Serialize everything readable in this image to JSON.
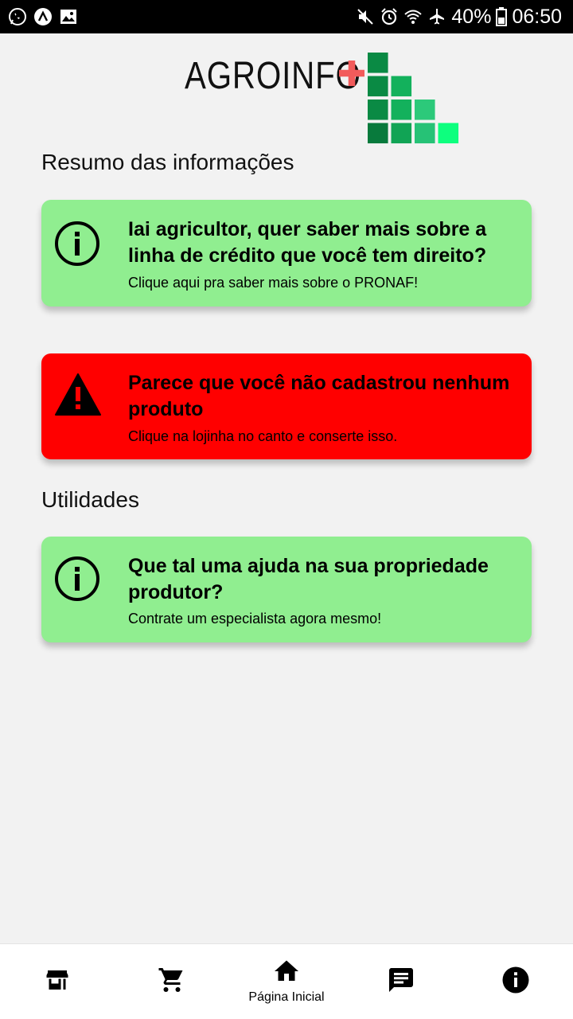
{
  "status_bar": {
    "battery": "40%",
    "time": "06:50",
    "left_icons": [
      "whatsapp-icon",
      "app-icon",
      "gallery-icon"
    ],
    "right_icons": [
      "mute-icon",
      "alarm-icon",
      "wifi-icon",
      "airplane-icon",
      "battery-icon"
    ]
  },
  "logo": {
    "text": "AGROINFO",
    "plus_color": "#f25b5b"
  },
  "sections": {
    "summary_title": "Resumo das informações",
    "utilities_title": "Utilidades"
  },
  "cards": [
    {
      "type": "info",
      "icon": "info-icon",
      "title": "Iai agricultor, quer saber mais sobre a linha de crédito que você tem direito?",
      "subtitle": "Clique aqui pra saber mais sobre o PRONAF!",
      "color": "#90ee90"
    },
    {
      "type": "alert",
      "icon": "warning-icon",
      "title": "Parece que você não cadastrou nenhum produto",
      "subtitle": "Clique na lojinha no canto e conserte isso.",
      "color": "#ff0000"
    },
    {
      "type": "info",
      "icon": "info-icon",
      "title": "Que tal uma ajuda na sua propriedade produtor?",
      "subtitle": "Contrate um especialista agora mesmo!",
      "color": "#90ee90"
    }
  ],
  "bottom_nav": {
    "items": [
      {
        "icon": "store-icon",
        "label": ""
      },
      {
        "icon": "cart-icon",
        "label": ""
      },
      {
        "icon": "home-icon",
        "label": "Página Inicial",
        "active": true
      },
      {
        "icon": "chat-icon",
        "label": ""
      },
      {
        "icon": "info-icon",
        "label": ""
      }
    ]
  }
}
